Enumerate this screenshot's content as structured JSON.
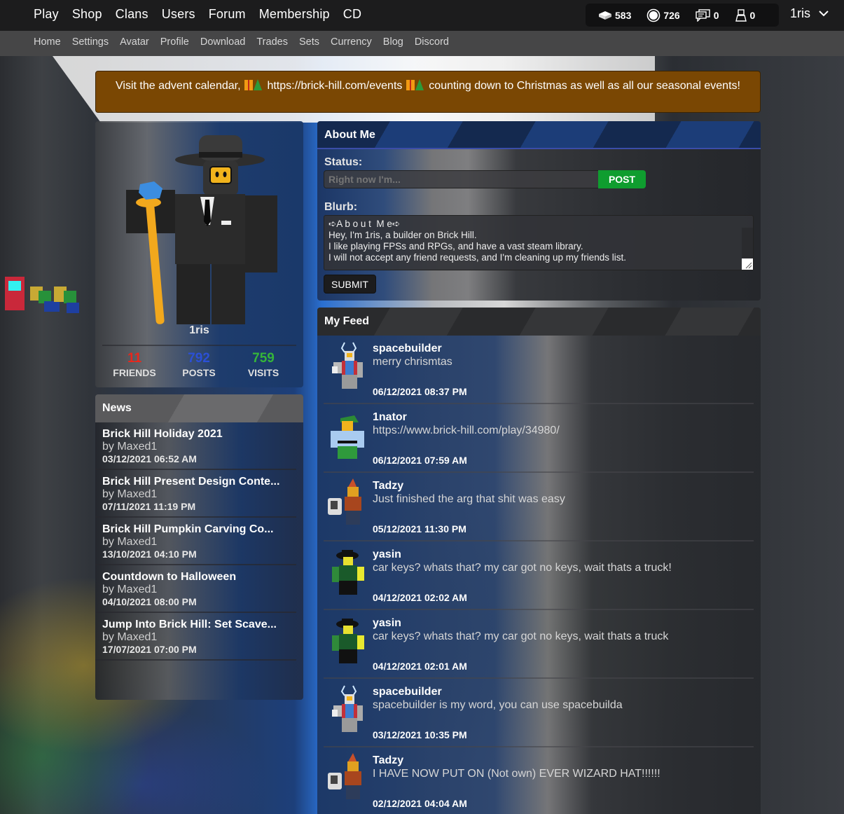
{
  "topnav": {
    "main": [
      "Play",
      "Shop",
      "Clans",
      "Users",
      "Forum",
      "Membership",
      "CD"
    ],
    "stats": {
      "bricks": "583",
      "bits": "726",
      "messages": "0",
      "friend_requests": "0"
    },
    "username": "1ris"
  },
  "subnav": [
    "Home",
    "Settings",
    "Avatar",
    "Profile",
    "Download",
    "Trades",
    "Sets",
    "Currency",
    "Blog",
    "Discord"
  ],
  "banner": {
    "part1": "Visit the advent calendar,",
    "link": "https://brick-hill.com/events",
    "part2": "counting down to Christmas as well as all our seasonal events!"
  },
  "profile": {
    "name": "1ris",
    "counts": [
      {
        "value": "11",
        "label": "FRIENDS",
        "color": "#e8271c"
      },
      {
        "value": "792",
        "label": "POSTS",
        "color": "#2b50d6"
      },
      {
        "value": "759",
        "label": "VISITS",
        "color": "#35b53a"
      }
    ]
  },
  "news": {
    "title": "News",
    "items": [
      {
        "title": "Brick Hill Holiday 2021",
        "author": "by Maxed1",
        "date": "03/12/2021 06:52 AM"
      },
      {
        "title": "Brick Hill Present Design Conte...",
        "author": "by Maxed1",
        "date": "07/11/2021 11:19 PM"
      },
      {
        "title": "Brick Hill Pumpkin Carving Co...",
        "author": "by Maxed1",
        "date": "13/10/2021 04:10 PM"
      },
      {
        "title": "Countdown to Halloween",
        "author": "by Maxed1",
        "date": "04/10/2021 08:00 PM"
      },
      {
        "title": "Jump Into Brick Hill: Set Scave...",
        "author": "by Maxed1",
        "date": "17/07/2021 07:00 PM"
      }
    ]
  },
  "about": {
    "title": "About Me",
    "status_label": "Status:",
    "status_placeholder": "Right now I'm...",
    "post_label": "POST",
    "blurb_label": "Blurb:",
    "blurb_value": "➪A b o u t  M e➪\nHey, I'm 1ris, a builder on Brick Hill.\nI like playing FPSs and RPGs, and have a vast steam library.\nI will not accept any friend requests, and I'm cleaning up my friends list.",
    "submit_label": "SUBMIT"
  },
  "feed": {
    "title": "My Feed",
    "items": [
      {
        "user": "spacebuilder",
        "message": "merry chrismtas",
        "date": "06/12/2021 08:37 PM",
        "avatar": "reindeer"
      },
      {
        "user": "1nator",
        "message": "https://www.brick-hill.com/play/34980/",
        "date": "06/12/2021 07:59 AM",
        "avatar": "elf"
      },
      {
        "user": "Tadzy",
        "message": "Just finished the arg that shit was easy",
        "date": "05/12/2021 11:30 PM",
        "avatar": "wizard"
      },
      {
        "user": "yasin",
        "message": "car keys? whats that? my car got no keys, wait thats a truck!",
        "date": "04/12/2021 02:02 AM",
        "avatar": "pirate"
      },
      {
        "user": "yasin",
        "message": "car keys? whats that? my car got no keys, wait thats a truck",
        "date": "04/12/2021 02:01 AM",
        "avatar": "pirate"
      },
      {
        "user": "spacebuilder",
        "message": "spacebuilder is my word, you can use spacebuilda",
        "date": "03/12/2021 10:35 PM",
        "avatar": "reindeer"
      },
      {
        "user": "Tadzy",
        "message": "I HAVE NOW PUT ON (Not own) EVER WIZARD HAT!!!!!!",
        "date": "02/12/2021 04:04 AM",
        "avatar": "wizard"
      }
    ]
  }
}
